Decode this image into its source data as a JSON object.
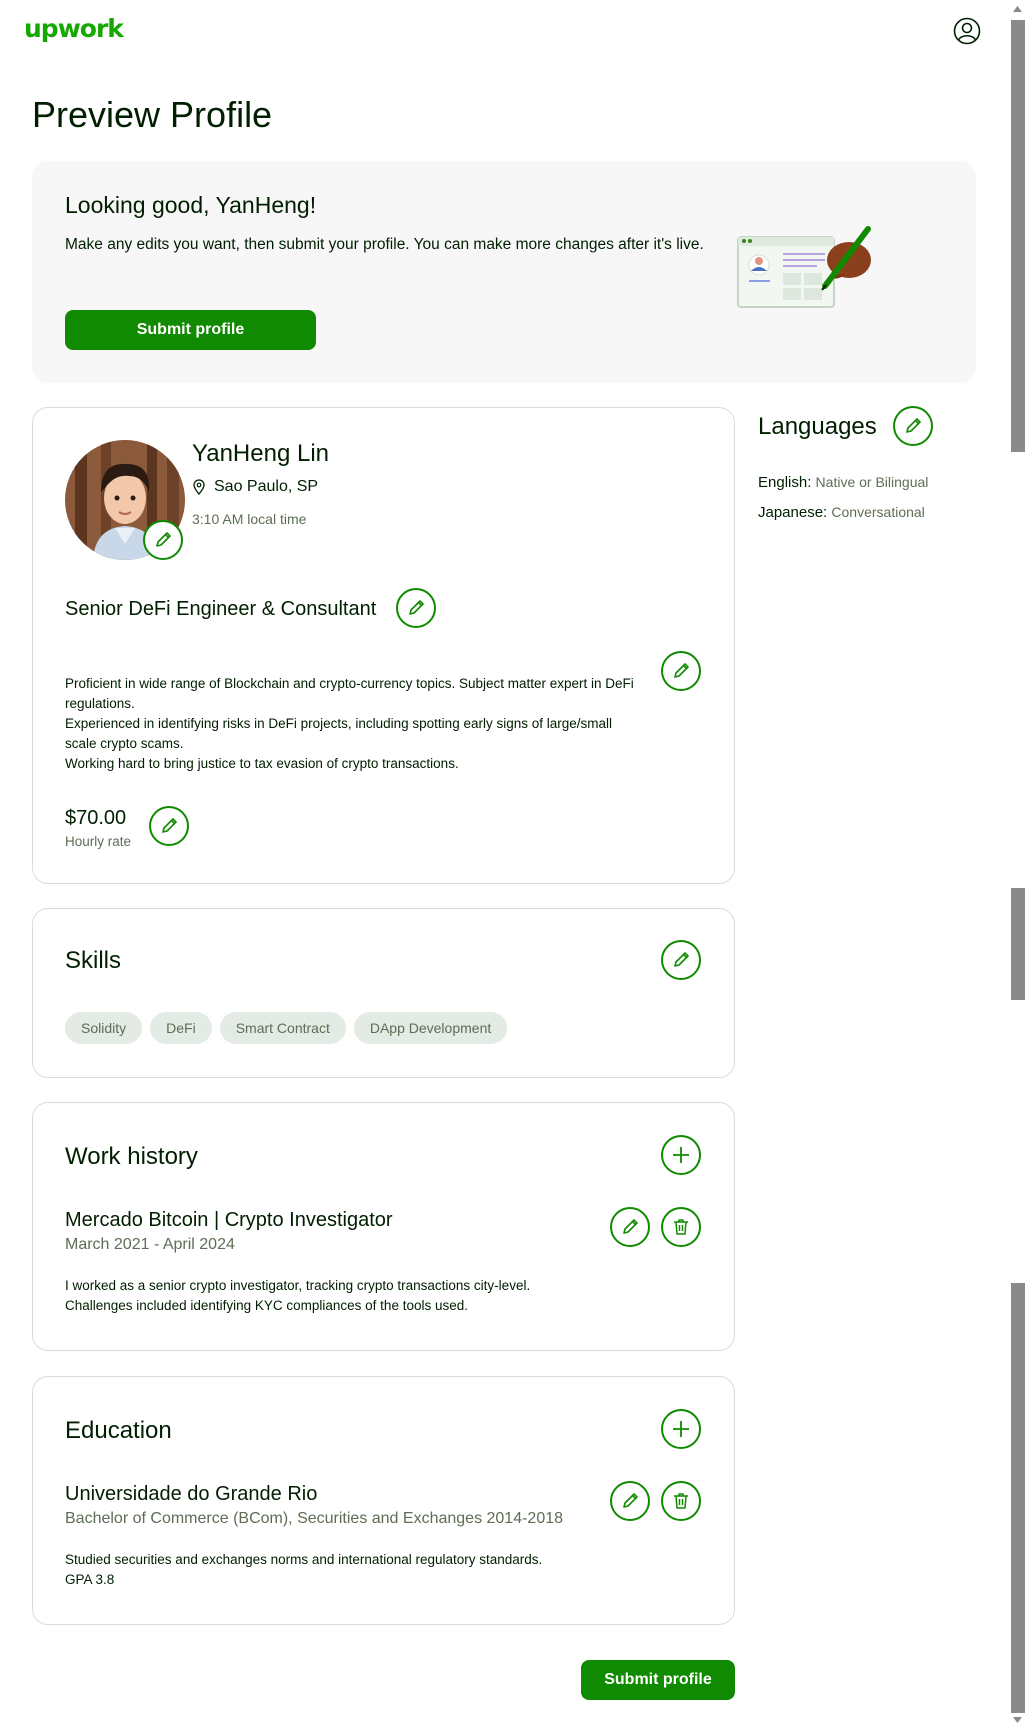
{
  "header": {
    "logo_text": "upwork",
    "account_icon": "user-circle-icon"
  },
  "page_title": "Preview Profile",
  "banner": {
    "heading": "Looking good, YanHeng!",
    "text": "Make any edits you want, then submit your profile. You can make more changes after it's live.",
    "submit_label": "Submit profile"
  },
  "profile": {
    "name": "YanHeng Lin",
    "location": "Sao Paulo,  SP",
    "local_time": "3:10 AM local time",
    "title": "Senior DeFi Engineer & Consultant",
    "overview_lines": [
      "Proficient in wide range of Blockchain and crypto-currency topics. Subject matter expert in DeFi regulations.",
      "Experienced in identifying risks in DeFi projects, including spotting early signs of large/small scale crypto scams.",
      "Working hard to bring justice to tax evasion of crypto transactions."
    ],
    "rate": "$70.00",
    "rate_label": "Hourly rate"
  },
  "languages": {
    "heading": "Languages",
    "items": [
      {
        "name": "English:",
        "level": "Native or Bilingual"
      },
      {
        "name": "Japanese:",
        "level": "Conversational"
      }
    ]
  },
  "skills": {
    "heading": "Skills",
    "items": [
      "Solidity",
      "DeFi",
      "Smart Contract",
      "DApp Development"
    ]
  },
  "work_history": {
    "heading": "Work history",
    "entry": {
      "title": "Mercado Bitcoin | Crypto Investigator",
      "dates": "March 2021 - April 2024",
      "desc_lines": [
        "I worked as a senior crypto investigator, tracking crypto transactions city-level.",
        "Challenges included identifying KYC compliances of the tools used."
      ]
    }
  },
  "education": {
    "heading": "Education",
    "entry": {
      "school": "Universidade do Grande Rio",
      "degree": "Bachelor of Commerce (BCom), Securities and Exchanges 2014-2018",
      "desc_lines": [
        "Studied securities and exchanges norms and international regulatory standards.",
        "GPA 3.8"
      ]
    }
  },
  "footer": {
    "submit_label": "Submit profile"
  },
  "colors": {
    "brand": "#14a800",
    "primary_button": "#108a00",
    "muted_text": "#5e6d55",
    "banner_bg": "#f7f7f7",
    "chip_bg": "#e4ebe4"
  }
}
